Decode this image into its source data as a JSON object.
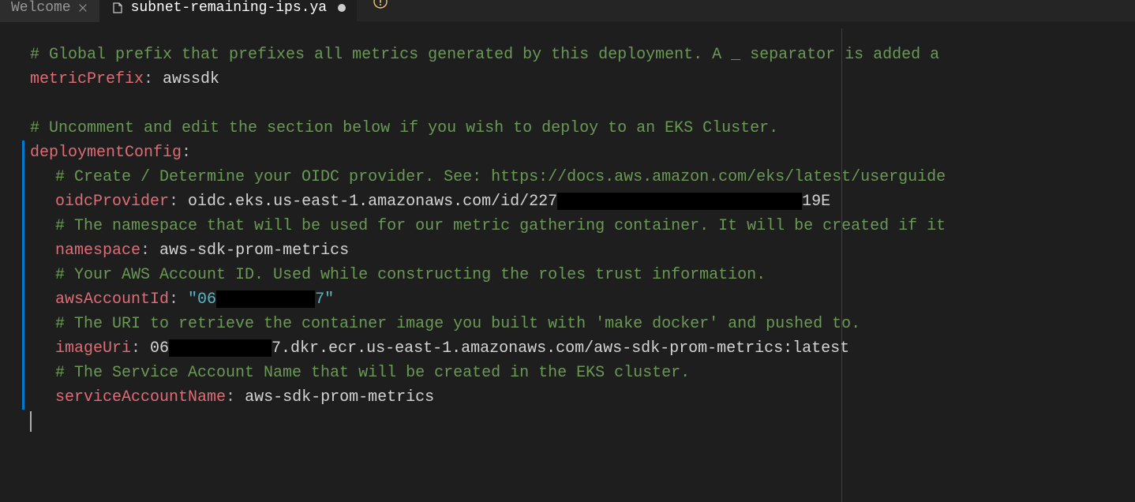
{
  "tabs": [
    {
      "label": "Welcome",
      "active": false,
      "dirty": false
    },
    {
      "label": "subnet-remaining-ips.ya",
      "active": true,
      "dirty": true
    }
  ],
  "lines": {
    "l1_comment": "# Global prefix that prefixes all metrics generated by this deployment.  A _ separator is added a",
    "l2_key": "metricPrefix",
    "l2_val": "awssdk",
    "l3_comment": "# Uncomment and edit the section below if you wish to deploy to an EKS Cluster.",
    "l4_key": "deploymentConfig",
    "l5_comment": "# Create / Determine your OIDC provider.  See: https://docs.aws.amazon.com/eks/latest/userguide",
    "l6_key": "oidcProvider",
    "l6_val_pre": "oidc.eks.us-east-1.amazonaws.com/id/227",
    "l6_val_post": "19E",
    "l7_comment": "# The namespace that will be used for our metric gathering container.  It will be created if it",
    "l8_key": "namespace",
    "l8_val": "aws-sdk-prom-metrics",
    "l9_comment": "# Your AWS Account ID.  Used while constructing the roles trust information.",
    "l10_key": "awsAccountId",
    "l10_val_pre": "\"06",
    "l10_val_post": "7\"",
    "l11_comment": "# The URI to retrieve the container image you built with 'make docker' and pushed to.",
    "l12_key": "imageUri",
    "l12_val_pre": "06",
    "l12_val_post": "7.dkr.ecr.us-east-1.amazonaws.com/aws-sdk-prom-metrics:latest",
    "l13_comment": "# The Service Account Name that will be created in the EKS cluster.",
    "l14_key": "serviceAccountName",
    "l14_val": "aws-sdk-prom-metrics"
  }
}
